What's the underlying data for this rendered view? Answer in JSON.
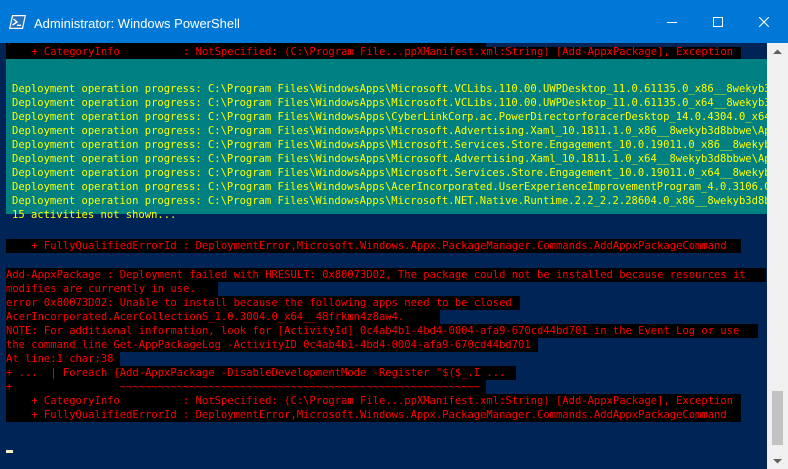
{
  "window": {
    "title": "Administrator: Windows PowerShell",
    "accent": "#0078d7",
    "console_bg": "#012456"
  },
  "console": {
    "top_block": [
      "+                    ~~~~~~~~~~~~~~~~~~~~~~~~~~~~~~~~~~~~~~~~~~~~~~~~~~~~",
      "    + CategoryInfo          : NotSpecified: (C:\\Program File...ppXManifest.xml:String) [Add-AppxPackage], Exception"
    ],
    "progress_block": {
      "lines": [
        "Deployment operation progress: C:\\Program Files\\WindowsApps\\Microsoft.VCLibs.110.00.UWPDesktop_11.0.61135.0_x86__8wekyb3d8bbwe",
        "Deployment operation progress: C:\\Program Files\\WindowsApps\\Microsoft.VCLibs.110.00.UWPDesktop_11.0.61135.0_x64__8wekyb3d8bbwe",
        "Deployment operation progress: C:\\Program Files\\WindowsApps\\CyberLinkCorp.ac.PowerDirectorforacerDesktop_14.0.4304.0_x64__",
        "Deployment operation progress: C:\\Program Files\\WindowsApps\\Microsoft.Advertising.Xaml_10.1811.1.0_x86__8wekyb3d8bbwe\\AppxManifest",
        "Deployment operation progress: C:\\Program Files\\WindowsApps\\Microsoft.Services.Store.Engagement_10.0.19011.0_x86__8wekyb3d8bbwe",
        "Deployment operation progress: C:\\Program Files\\WindowsApps\\Microsoft.Advertising.Xaml_10.1811.1.0_x64__8wekyb3d8bbwe\\AppxManifest",
        "Deployment operation progress: C:\\Program Files\\WindowsApps\\Microsoft.Services.Store.Engagement_10.0.19011.0_x64__8wekyb3d8bbwe",
        "Deployment operation progress: C:\\Program Files\\WindowsApps\\AcerIncorporated.UserExperienceImprovementProgram_4.0.3106.0_x64",
        "Deployment operation progress: C:\\Program Files\\WindowsApps\\Microsoft.NET.Native.Runtime.2.2_2.2.28604.0_x86__8wekyb3d8bbwe",
        "15 activities not shown..."
      ],
      "bg": "#008080",
      "text_color": "#ffff00"
    },
    "fq_line_1": "    + FullyQualifiedErrorId : DeploymentError,Microsoft.Windows.Appx.PackageManager.Commands.AddAppxPackageCommand",
    "error_block": [
      "Add-AppxPackage : Deployment failed with HRESULT: 0x80073D02, The package could not be installed because resources it",
      "modifies are currently in use.",
      "error 0x80073D02: Unable to install because the following apps need to be closed",
      "AcerIncorporated.AcerCollectionS_1.0.3004.0_x64__48frkmn4z8aw4.",
      "NOTE: For additional information, look for [ActivityId] 0c4ab4b1-4bd4-0004-afa9-670cd44bd701 in the Event Log or use",
      "the command line Get-AppPackageLog -ActivityID 0c4ab4b1-4bd4-0004-afa9-670cd44bd701",
      "At line:1 char:38",
      "+ ...  | Foreach {Add-AppxPackage -DisableDevelopmentMode -Register \"$($_.I ...",
      "+                 ~~~~~~~~~~~~~~~~~~~~~~~~~~~~~~~~~~~~~~~~~~~~~~~~~~~~~~~~~",
      "    + CategoryInfo          : NotSpecified: (C:\\Program File...ppXManifest.xml:String) [Add-AppxPackage], Exception",
      "    + FullyQualifiedErrorId : DeploymentError,Microsoft.Windows.Appx.PackageManager.Commands.AddAppxPackageCommand"
    ],
    "error_color": "#ff0000"
  },
  "icons": {
    "app": "powershell-icon",
    "minimize": "minimize-icon",
    "maximize": "maximize-icon",
    "close": "close-icon",
    "scroll_up": "scroll-up-arrow-icon",
    "scroll_down": "scroll-down-arrow-icon"
  }
}
